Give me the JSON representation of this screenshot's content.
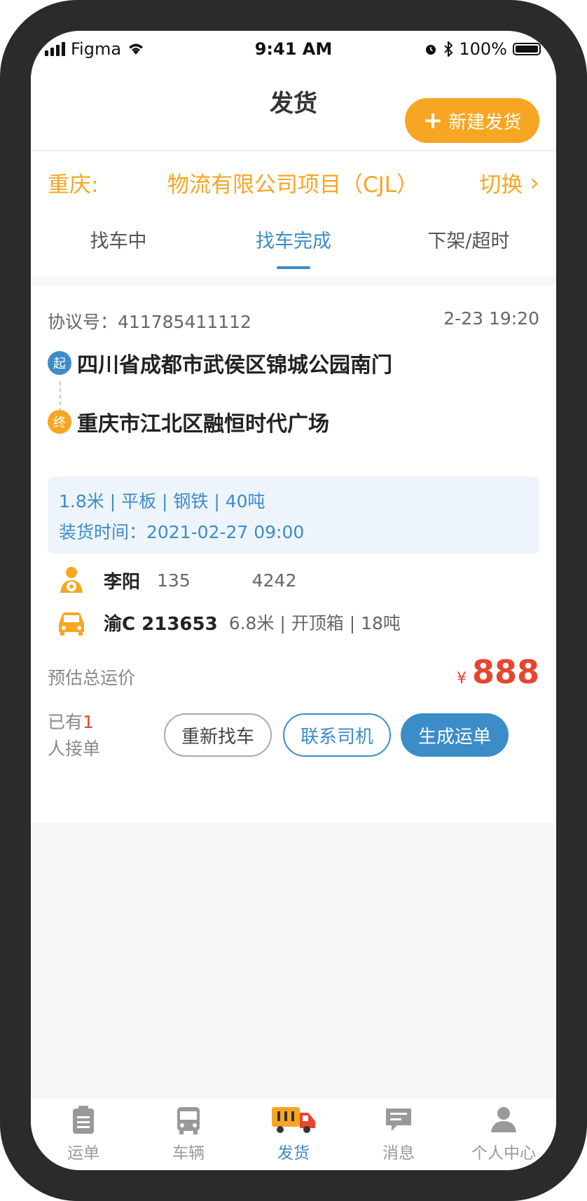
{
  "status_bar": {
    "carrier": "Figma",
    "time": "9:41 AM",
    "battery": "100%"
  },
  "header": {
    "title": "发货",
    "new_button": "新建发货"
  },
  "project": {
    "name": "重庆:          物流有限公司项目（CJL）",
    "switch_label": "切换"
  },
  "tabs": [
    {
      "label": "找车中",
      "active": false
    },
    {
      "label": "找车完成",
      "active": true
    },
    {
      "label": "下架/超时",
      "active": false
    }
  ],
  "order": {
    "agreement_label": "协议号：",
    "agreement_no": "411785411112",
    "time": "2-23 19:20",
    "from_tag": "起",
    "from": "四川省成都市武侯区锦城公园南门",
    "to_tag": "终",
    "to": "重庆市江北区融恒时代广场",
    "cargo": "1.8米 | 平板 | 钢铁 | 40吨",
    "load_time_label": "装货时间：",
    "load_time": "2021-02-27 09:00",
    "driver_name": "李阳",
    "driver_phone_prefix": "135",
    "driver_phone_suffix": "4242",
    "plate": "渝C 213653",
    "vehicle_desc": "6.8米 | 开顶箱 | 18吨",
    "price_label": "预估总运价",
    "price_currency": "¥",
    "price": "888",
    "accept_prefix": "已有",
    "accept_count": "1",
    "accept_suffix": "人接单",
    "btn_retry": "重新找车",
    "btn_contact": "联系司机",
    "btn_generate": "生成运单"
  },
  "bottom_nav": [
    {
      "label": "运单",
      "icon": "clipboard-icon"
    },
    {
      "label": "车辆",
      "icon": "bus-icon"
    },
    {
      "label": "发货",
      "icon": "truck-icon",
      "active": true
    },
    {
      "label": "消息",
      "icon": "message-icon"
    },
    {
      "label": "个人中心",
      "icon": "person-icon"
    }
  ],
  "colors": {
    "accent_blue": "#3c8cc8",
    "accent_orange": "#f7a623",
    "price_red": "#e8452f"
  }
}
